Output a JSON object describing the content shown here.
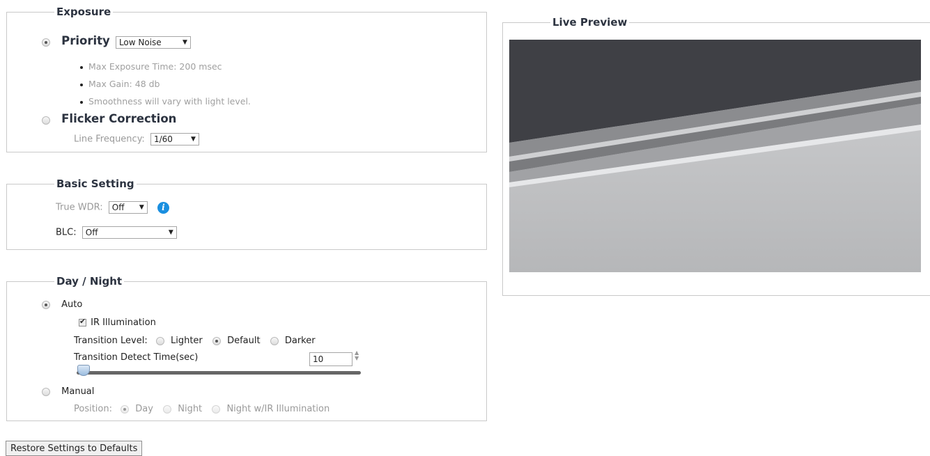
{
  "exposure": {
    "title": "Exposure",
    "priority_label": "Priority",
    "priority_value": "Low Noise",
    "notes": [
      "Max Exposure Time: 200 msec",
      "Max Gain: 48 db",
      "Smoothness will vary with light level."
    ],
    "flicker_label": "Flicker Correction",
    "line_freq_label": "Line Frequency:",
    "line_freq_value": "1/60"
  },
  "basic": {
    "title": "Basic Setting",
    "wdr_label": "True WDR:",
    "wdr_value": "Off",
    "blc_label": "BLC:",
    "blc_value": "Off"
  },
  "daynight": {
    "title": "Day / Night",
    "auto_label": "Auto",
    "ir_label": "IR Illumination",
    "transition_label": "Transition Level:",
    "lighter": "Lighter",
    "default": "Default",
    "darker": "Darker",
    "detect_label": "Transition Detect Time(sec)",
    "detect_value": "10",
    "manual_label": "Manual",
    "position_label": "Position:",
    "day": "Day",
    "night": "Night",
    "night_ir": "Night w/IR Illumination"
  },
  "preview": {
    "title": "Live Preview"
  },
  "restore_label": "Restore Settings to Defaults",
  "colors": {
    "accent": "#2c3340",
    "info": "#1a8fe0"
  }
}
